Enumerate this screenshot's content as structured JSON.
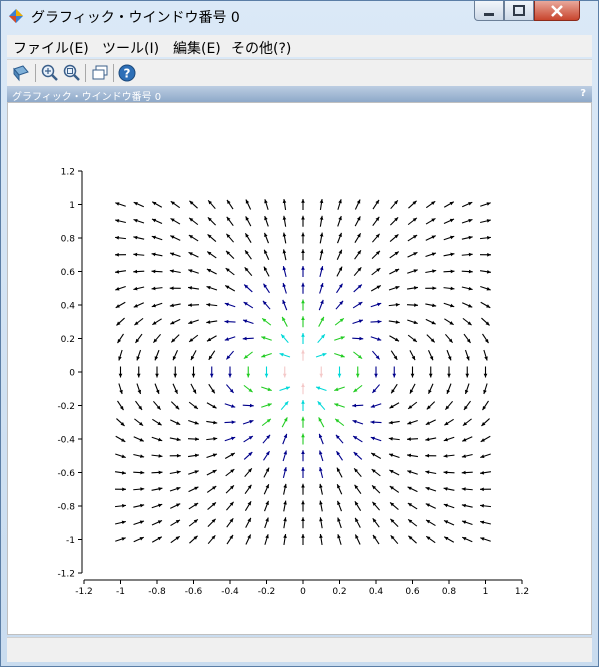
{
  "window": {
    "title": "グラフィック・ウインドウ番号 0",
    "menus": [
      "ファイル(E)",
      "ツール(I)",
      "編集(E)",
      "その他(?)"
    ],
    "toolbar": [
      "rotate-icon",
      "zoom-in-icon",
      "zoom-reset-icon",
      "windows-icon",
      "help-icon"
    ],
    "panel_title": "グラフィック・ウインドウ番号 0",
    "panel_help": "?"
  },
  "chart_data": {
    "type": "quiver",
    "title": "",
    "xlabel": "",
    "ylabel": "",
    "xlim": [
      -1.2,
      1.2
    ],
    "ylim": [
      -1.2,
      1.2
    ],
    "x_ticks": [
      -1.2,
      -1,
      -0.8,
      -0.6,
      -0.4,
      -0.2,
      0,
      0.2,
      0.4,
      0.6,
      0.8,
      1,
      1.2
    ],
    "y_ticks": [
      -1.2,
      -1,
      -0.8,
      -0.6,
      -0.4,
      -0.2,
      0,
      0.2,
      0.4,
      0.6,
      0.8,
      1,
      1.2
    ],
    "grid": false,
    "field": "dipole field (u, v) = (3xy/r^5, (2y^2 - x^2)/r^5) sampled on a 21 x 21 grid over [-1, 1], rendered with normalized arrows colored by magnitude",
    "grid_x": [
      -1,
      -0.9,
      -0.8,
      -0.7,
      -0.6,
      -0.5,
      -0.4,
      -0.3,
      -0.2,
      -0.1,
      0,
      0.1,
      0.2,
      0.3,
      0.4,
      0.5,
      0.6,
      0.7,
      0.8,
      0.9,
      1
    ],
    "grid_y": [
      -1,
      -0.9,
      -0.8,
      -0.7,
      -0.6,
      -0.5,
      -0.4,
      -0.3,
      -0.2,
      -0.1,
      0,
      0.1,
      0.2,
      0.3,
      0.4,
      0.5,
      0.6,
      0.7,
      0.8,
      0.9,
      1
    ],
    "colors": {
      "low": "#000000",
      "mid1": "#00008b",
      "mid2": "#22cc22",
      "mid3": "#00d8d8",
      "high": "#f4c8c8"
    }
  }
}
